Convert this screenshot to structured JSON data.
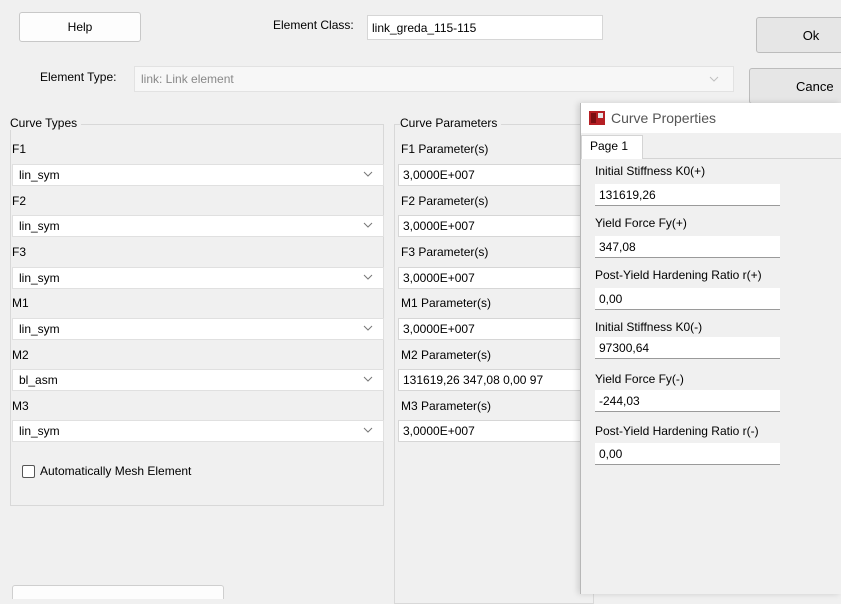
{
  "top": {
    "help_label": "Help",
    "element_class_label": "Element Class:",
    "element_class_value": "link_greda_115-115",
    "ok_label": "Ok",
    "cancel_label": "Cance",
    "element_type_label": "Element Type:",
    "element_type_value": "link: Link element"
  },
  "curve_types": {
    "heading": "Curve Types",
    "items": [
      {
        "name": "F1",
        "value": "lin_sym"
      },
      {
        "name": "F2",
        "value": "lin_sym"
      },
      {
        "name": "F3",
        "value": "lin_sym"
      },
      {
        "name": "M1",
        "value": "lin_sym"
      },
      {
        "name": "M2",
        "value": "bl_asm"
      },
      {
        "name": "M3",
        "value": "lin_sym"
      }
    ],
    "auto_mesh_label": "Automatically Mesh Element",
    "auto_mesh_checked": false
  },
  "curve_params": {
    "heading": "Curve Parameters",
    "items": [
      {
        "label": "F1 Parameter(s)",
        "value": "3,0000E+007"
      },
      {
        "label": "F2 Parameter(s)",
        "value": "3,0000E+007"
      },
      {
        "label": "F3 Parameter(s)",
        "value": "3,0000E+007"
      },
      {
        "label": "M1 Parameter(s)",
        "value": "3,0000E+007"
      },
      {
        "label": "M2 Parameter(s)",
        "value": "131619,26  347,08  0,00  97"
      },
      {
        "label": "M3 Parameter(s)",
        "value": "3,0000E+007"
      }
    ]
  },
  "curve_properties": {
    "title": "Curve Properties",
    "tab": "Page 1",
    "fields": [
      {
        "label": "Initial Stiffness K0(+)",
        "value": "131619,26"
      },
      {
        "label": "Yield Force Fy(+)",
        "value": "347,08"
      },
      {
        "label": "Post-Yield Hardening Ratio r(+)",
        "value": "0,00"
      },
      {
        "label": "Initial Stiffness K0(-)",
        "value": "97300,64"
      },
      {
        "label": "Yield Force Fy(-)",
        "value": "-244,03"
      },
      {
        "label": "Post-Yield Hardening Ratio r(-)",
        "value": "0,00"
      }
    ]
  },
  "colors": {
    "app_icon": "#b51f24",
    "window_bg": "#f0f0f0"
  }
}
